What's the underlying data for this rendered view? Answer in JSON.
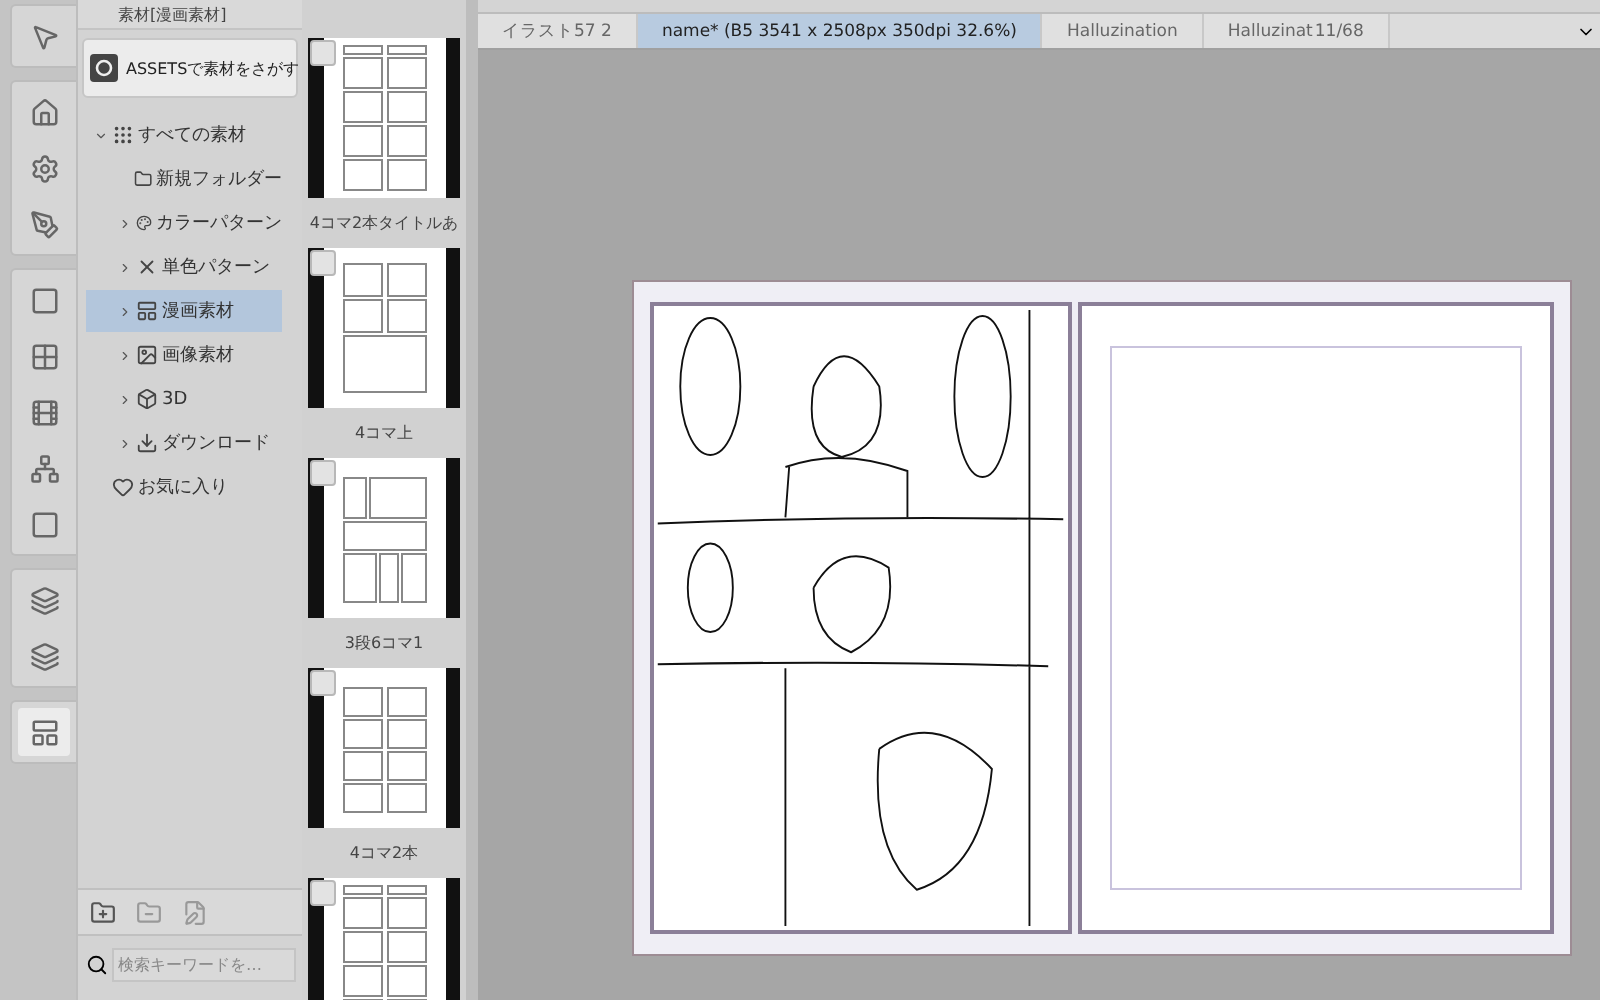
{
  "document_tabs": [
    {
      "label": "イラスト57 2",
      "selected": false
    },
    {
      "label": "name* (B5 3541 x 2508px 350dpi 32.6%)",
      "selected": true
    },
    {
      "label": "Halluzination",
      "selected": false
    },
    {
      "label": "Halluzinat",
      "counter": "11/68",
      "selected": false
    }
  ],
  "materials_panel": {
    "tab_label": "素材[漫画素材]",
    "assets_button": "ASSETSで素材をさがす",
    "tree": [
      {
        "label": "すべての素材",
        "kind": "branch",
        "expanded": true,
        "selected": false,
        "children": [
          {
            "label": "新規フォルダー",
            "kind": "leaf",
            "selected": false
          },
          {
            "label": "カラーパターン",
            "kind": "branch",
            "expanded": false,
            "selected": false
          },
          {
            "label": "単色パターン",
            "kind": "branch",
            "expanded": false,
            "selected": false
          },
          {
            "label": "漫画素材",
            "kind": "branch",
            "expanded": false,
            "selected": true
          },
          {
            "label": "画像素材",
            "kind": "branch",
            "expanded": false,
            "selected": false
          },
          {
            "label": "3D",
            "kind": "branch",
            "expanded": false,
            "selected": false
          },
          {
            "label": "ダウンロード",
            "kind": "branch",
            "expanded": false,
            "selected": false
          }
        ]
      },
      {
        "label": "お気に入り",
        "kind": "leaf",
        "selected": false
      }
    ],
    "search": {
      "placeholder": "検索キーワードを…"
    }
  },
  "thumbnails": [
    {
      "label": "4コマ2本タイトルあ",
      "kind": "two-column-title",
      "checked": false
    },
    {
      "label": "4コマ上",
      "kind": "four-top",
      "checked": false
    },
    {
      "label": "3段6コマ1",
      "kind": "three-tier",
      "checked": false
    },
    {
      "label": "4コマ2本",
      "kind": "two-column",
      "checked": false
    },
    {
      "kind": "two-column-title",
      "checked": false
    }
  ]
}
